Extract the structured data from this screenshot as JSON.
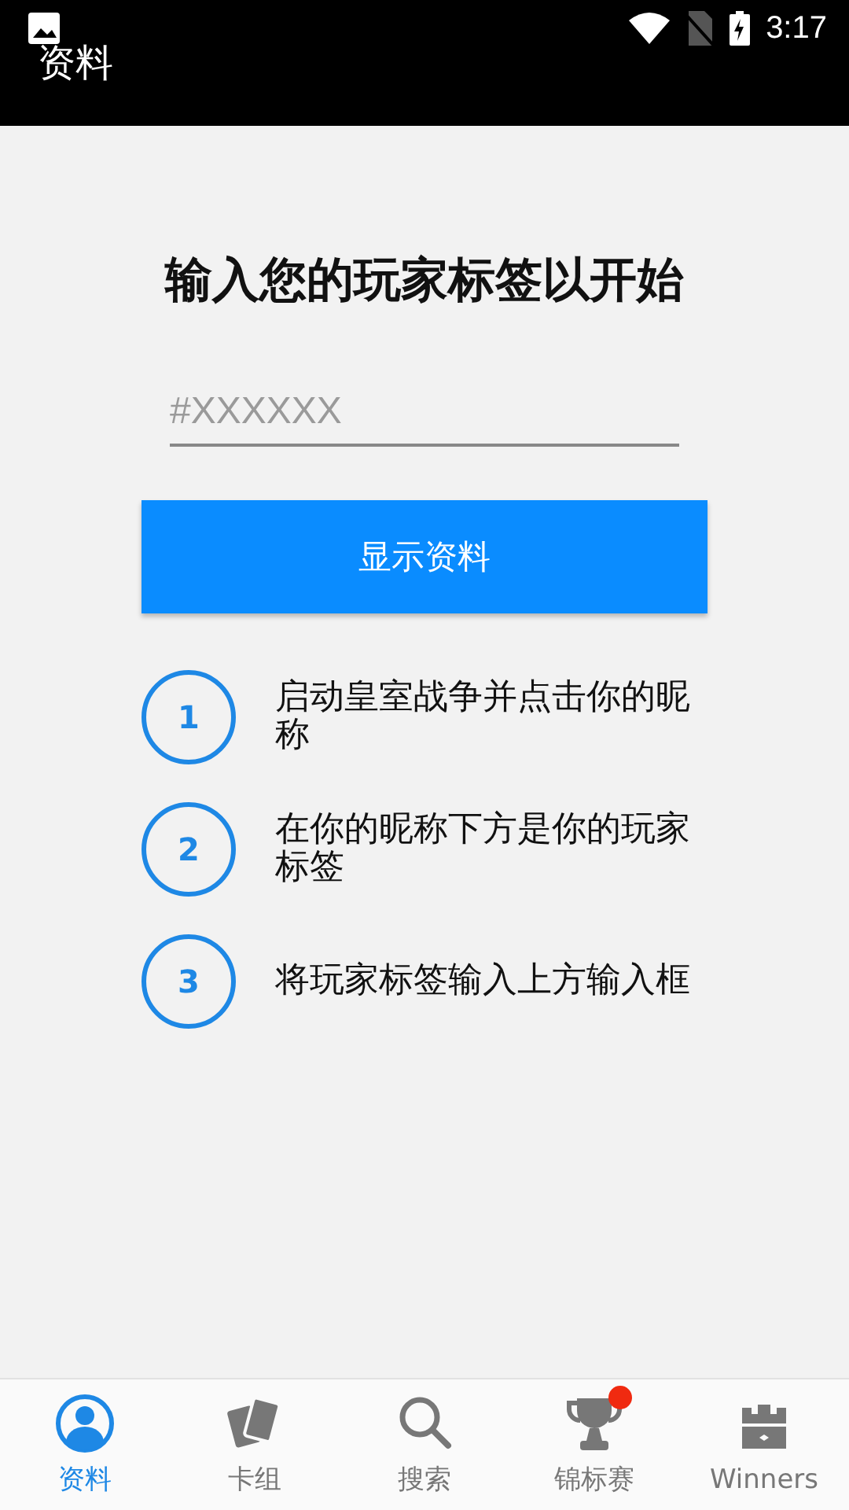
{
  "status_bar": {
    "time": "3:17"
  },
  "header": {
    "title": "资料"
  },
  "heading": "输入您的玩家标签以开始",
  "tag_field": {
    "placeholder": "#XXXXXX"
  },
  "show_button": "显示资料",
  "steps": [
    {
      "number": "1",
      "text": "启动皇室战争并点击你的昵称"
    },
    {
      "number": "2",
      "text": "在你的昵称下方是你的玩家标签"
    },
    {
      "number": "3",
      "text": "将玩家标签输入上方输入框"
    }
  ],
  "nav": [
    {
      "kind": "profile",
      "label": "资料",
      "selected": true,
      "badge": false
    },
    {
      "kind": "cards",
      "label": "卡组",
      "selected": false,
      "badge": false
    },
    {
      "kind": "search",
      "label": "搜索",
      "selected": false,
      "badge": false
    },
    {
      "kind": "trophy",
      "label": "锦标赛",
      "selected": false,
      "badge": true
    },
    {
      "kind": "castle",
      "label": "Winners",
      "selected": false,
      "badge": false
    }
  ]
}
